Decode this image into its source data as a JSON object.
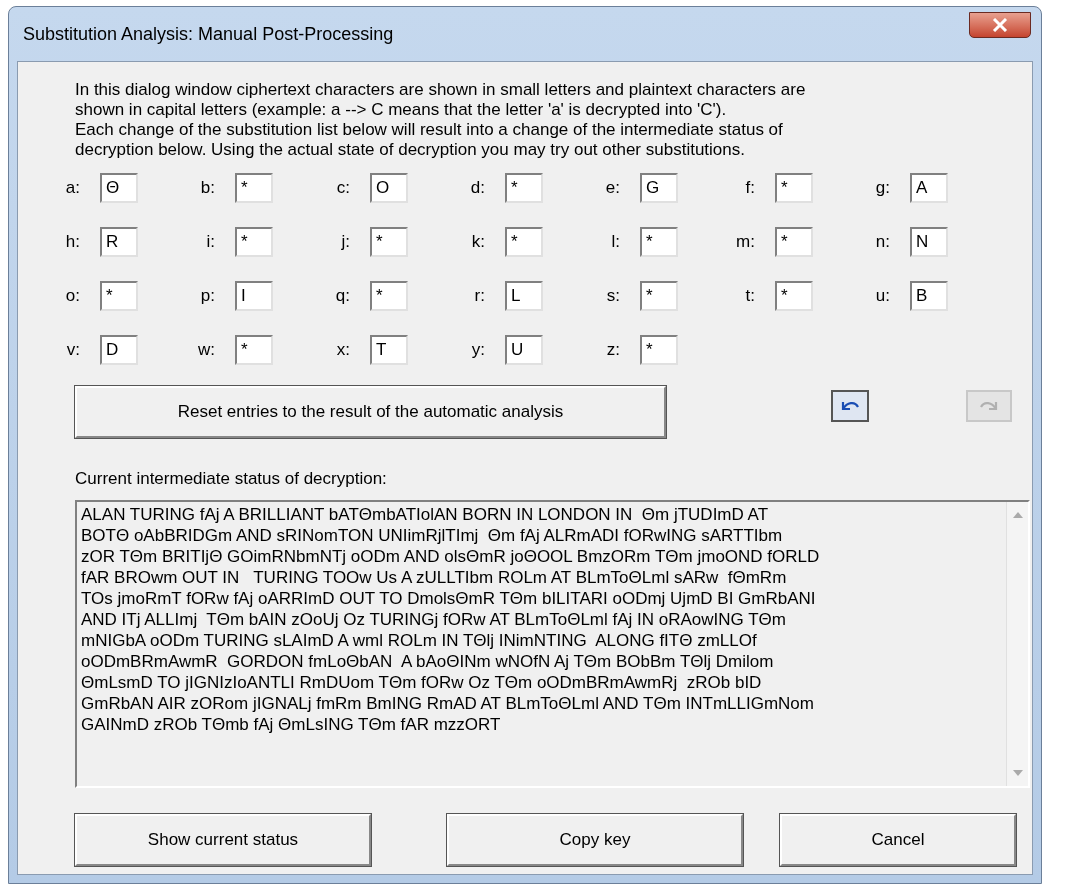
{
  "window": {
    "title": "Substitution Analysis: Manual Post-Processing"
  },
  "intro_lines": [
    "In this dialog window ciphertext characters are shown in small letters and plaintext characters are",
    "shown in capital letters (example: a --> C means that the letter 'a' is decrypted into 'C').",
    "Each change of the substitution list below will result into a change of the intermediate status of",
    "decryption below. Using the actual state of decryption you may try out other substitutions."
  ],
  "substitutions": [
    {
      "cipher": "a:",
      "plain": "Θ"
    },
    {
      "cipher": "b:",
      "plain": "*"
    },
    {
      "cipher": "c:",
      "plain": "O"
    },
    {
      "cipher": "d:",
      "plain": "*"
    },
    {
      "cipher": "e:",
      "plain": "G"
    },
    {
      "cipher": "f:",
      "plain": "*"
    },
    {
      "cipher": "g:",
      "plain": "A"
    },
    {
      "cipher": "h:",
      "plain": "R"
    },
    {
      "cipher": "i:",
      "plain": "*"
    },
    {
      "cipher": "j:",
      "plain": "*"
    },
    {
      "cipher": "k:",
      "plain": "*"
    },
    {
      "cipher": "l:",
      "plain": "*"
    },
    {
      "cipher": "m:",
      "plain": "*"
    },
    {
      "cipher": "n:",
      "plain": "N"
    },
    {
      "cipher": "o:",
      "plain": "*"
    },
    {
      "cipher": "p:",
      "plain": "I"
    },
    {
      "cipher": "q:",
      "plain": "*"
    },
    {
      "cipher": "r:",
      "plain": "L"
    },
    {
      "cipher": "s:",
      "plain": "*"
    },
    {
      "cipher": "t:",
      "plain": "*"
    },
    {
      "cipher": "u:",
      "plain": "B"
    },
    {
      "cipher": "v:",
      "plain": "D"
    },
    {
      "cipher": "w:",
      "plain": "*"
    },
    {
      "cipher": "x:",
      "plain": "T"
    },
    {
      "cipher": "y:",
      "plain": "U"
    },
    {
      "cipher": "z:",
      "plain": "*"
    }
  ],
  "reset_button": "Reset entries to the result of the automatic analysis",
  "undo": {
    "disabled": false
  },
  "redo": {
    "disabled": true
  },
  "status_label": "Current intermediate status of decryption:",
  "status_lines": [
    "ALAN TURING fAj A BRILLIANT bATΘmbATIolAN BORN IN LONDON IN  Θm jTUDImD AT",
    "BOTΘ oAbBRIDGm AND sRINomTON UNIimRjlTImj  Θm fAj ALRmADI fORwING sARTTIbm",
    "zOR TΘm BRITIjΘ GOimRNbmNTj oODm AND olsΘmR joΘOOL BmzORm TΘm jmoOND fORLD",
    "fAR BROwm OUT IN   TURING TOOw Us A zULLTIbm ROLm AT BLmToΘLml sARw  fΘmRm",
    "TOs jmoRmT fORw fAj oARRImD OUT TO DmolsΘmR TΘm bILITARI oODmj UjmD BI GmRbANI",
    "AND ITj ALLImj  TΘm bAIN zOoUj Oz TURINGj fORw AT BLmToΘLml fAj IN oRAowING TΘm",
    "mNIGbA oODm TURING sLAImD A wml ROLm IN TΘlj INimNTING  ALONG fITΘ zmLLOf",
    "oODmBRmAwmR  GORDON fmLoΘbAN  A bAoΘINm wNOfN Aj TΘm BObBm TΘlj Dmilom",
    "ΘmLsmD TO jIGNIzIoANTLI RmDUom TΘm fORw Oz TΘm oODmBRmAwmRj  zROb bID",
    "GmRbAN AIR zORom jIGNALj fmRm BmING RmAD AT BLmToΘLml AND TΘm INTmLLIGmNom",
    "GAINmD zROb TΘmb fAj ΘmLsING TΘm fAR mzzORT"
  ],
  "buttons": [
    "Show current status",
    "Copy key",
    "Cancel"
  ]
}
